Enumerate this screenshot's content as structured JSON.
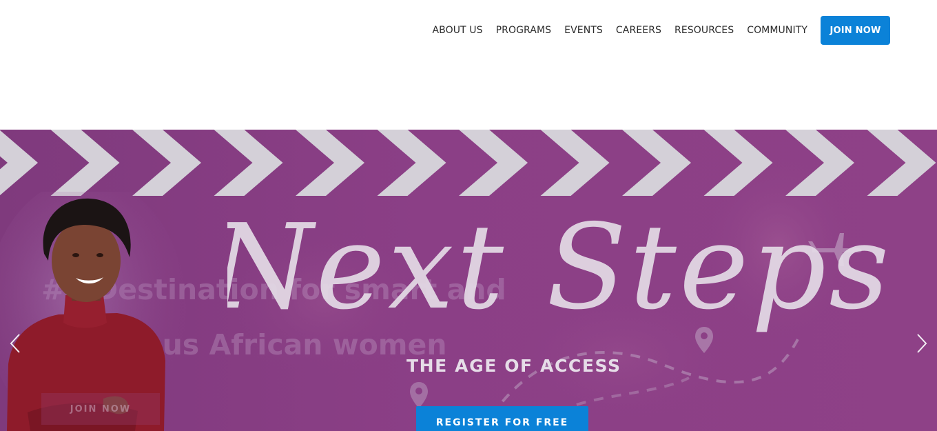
{
  "nav": {
    "items": [
      "ABOUT US",
      "PROGRAMS",
      "EVENTS",
      "CAREERS",
      "RESOURCES",
      "COMMUNITY"
    ],
    "join_label": "JOIN NOW"
  },
  "hero": {
    "title": "Next Steps",
    "subtitle": "THE AGE OF ACCESS",
    "ghost_line_1": "#1 Destination for smart and",
    "ghost_line_2": "ambitious African women",
    "ghost_button": "JOIN NOW",
    "register_label": "REGISTER FOR FREE"
  },
  "colors": {
    "accent_blue": "#0b82d8",
    "hero_purple": "#8c3f86",
    "chevron": "#d4d0d8"
  },
  "icons": {
    "prev": "chevron-left-icon",
    "next": "chevron-right-icon",
    "plane": "airplane-icon",
    "pin": "map-pin-icon"
  }
}
